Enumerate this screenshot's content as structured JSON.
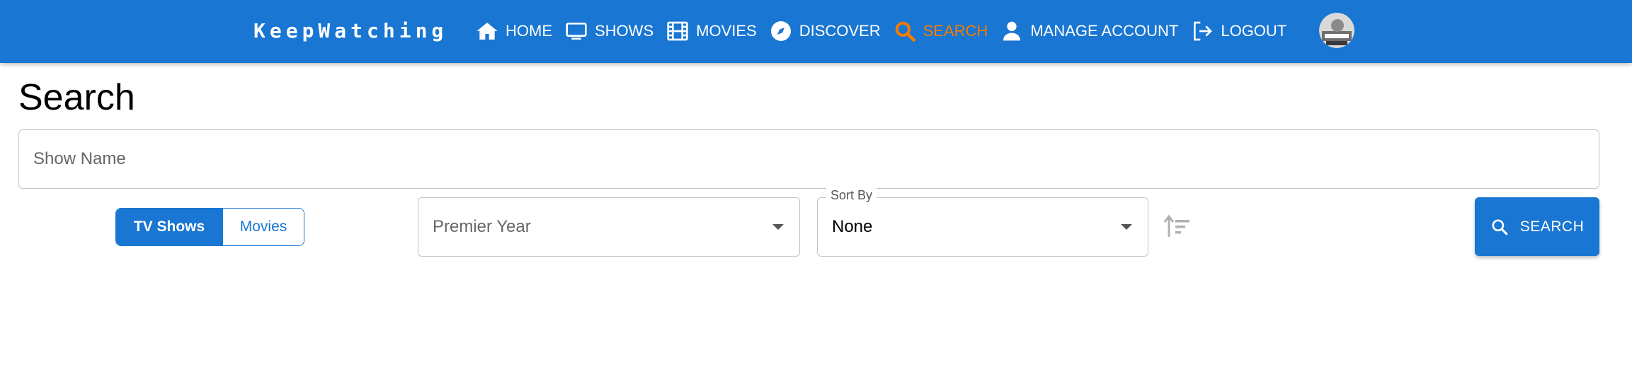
{
  "brand": "KeepWatching",
  "nav": {
    "items": [
      {
        "label": "HOME",
        "icon": "home-icon"
      },
      {
        "label": "SHOWS",
        "icon": "tv-icon"
      },
      {
        "label": "MOVIES",
        "icon": "film-icon"
      },
      {
        "label": "DISCOVER",
        "icon": "compass-icon"
      },
      {
        "label": "SEARCH",
        "icon": "search-icon",
        "active": true
      },
      {
        "label": "MANAGE ACCOUNT",
        "icon": "person-icon"
      },
      {
        "label": "LOGOUT",
        "icon": "logout-icon"
      }
    ],
    "avatar": "avatar"
  },
  "page": {
    "title": "Search"
  },
  "search": {
    "placeholder": "Show Name",
    "value": "",
    "media_type": {
      "options": [
        "TV Shows",
        "Movies"
      ],
      "selected": "TV Shows"
    },
    "premier_year": {
      "placeholder": "Premier Year"
    },
    "sort_by": {
      "label": "Sort By",
      "value": "None"
    },
    "button": "SEARCH"
  },
  "colors": {
    "primary": "#1976d2",
    "active_nav": "#f57c00",
    "border": "#c4c4c4"
  }
}
